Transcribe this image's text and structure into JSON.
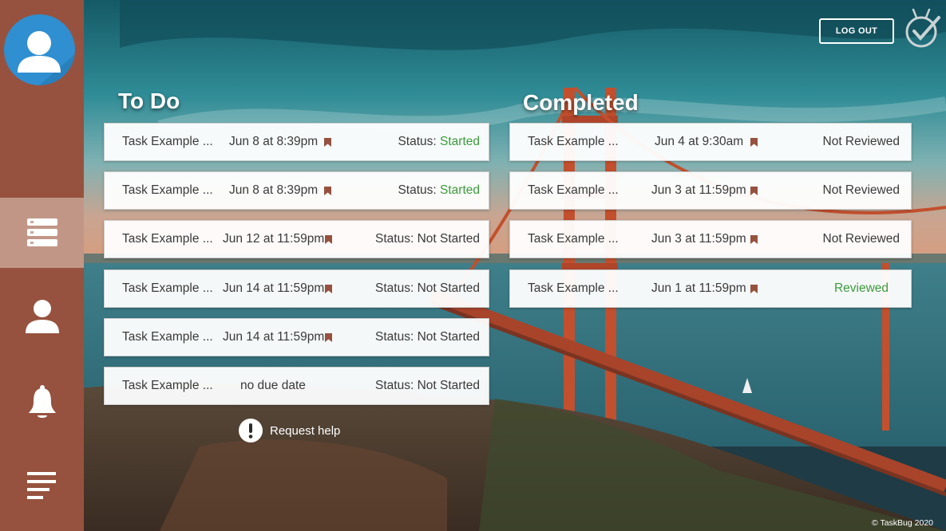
{
  "sidebar": {
    "avatar_icon": "user-avatar-icon",
    "items": [
      {
        "icon": "list-icon",
        "active": true
      },
      {
        "icon": "user-icon",
        "active": false
      },
      {
        "icon": "bell-icon",
        "active": false
      },
      {
        "icon": "menu-icon",
        "active": false
      }
    ]
  },
  "header": {
    "logout_label": "LOG OUT",
    "logo_icon": "taskbug-logo-icon"
  },
  "todo": {
    "title": "To Do",
    "tasks": [
      {
        "name": "Task Example ...",
        "due": "Jun 8 at 8:39pm",
        "status_label": "Status:",
        "status_value": "Started"
      },
      {
        "name": "Task Example ...",
        "due": "Jun 8 at 8:39pm",
        "status_label": "Status:",
        "status_value": "Started"
      },
      {
        "name": "Task Example ...",
        "due": "Jun 12 at 11:59pm",
        "status_label": "Status:",
        "status_value": "Not Started"
      },
      {
        "name": "Task Example ...",
        "due": "Jun 14 at 11:59pm",
        "status_label": "Status:",
        "status_value": "Not Started"
      },
      {
        "name": "Task Example ...",
        "due": "Jun 14 at 11:59pm",
        "status_label": "Status:",
        "status_value": "Not Started"
      },
      {
        "name": "Task Example ...",
        "due": "no due date",
        "status_label": "Status:",
        "status_value": "Not Started"
      }
    ]
  },
  "completed": {
    "title": "Completed",
    "tasks": [
      {
        "name": "Task Example ...",
        "due": "Jun 4 at 9:30am",
        "review": "Not Reviewed"
      },
      {
        "name": "Task Example ...",
        "due": "Jun 3 at 11:59pm",
        "review": "Not Reviewed"
      },
      {
        "name": "Task Example ...",
        "due": "Jun 3 at 11:59pm",
        "review": "Not Reviewed"
      },
      {
        "name": "Task Example ...",
        "due": "Jun 1 at 11:59pm",
        "review": "Reviewed"
      }
    ]
  },
  "help": {
    "label": "Request help",
    "icon": "exclamation-icon"
  },
  "footer": {
    "copyright": "© TaskBug 2020"
  },
  "colors": {
    "sidebar": "#96523f",
    "bookmark": "#96523f",
    "status_green": "#3c9b3c",
    "avatar": "#2f8fd0"
  }
}
